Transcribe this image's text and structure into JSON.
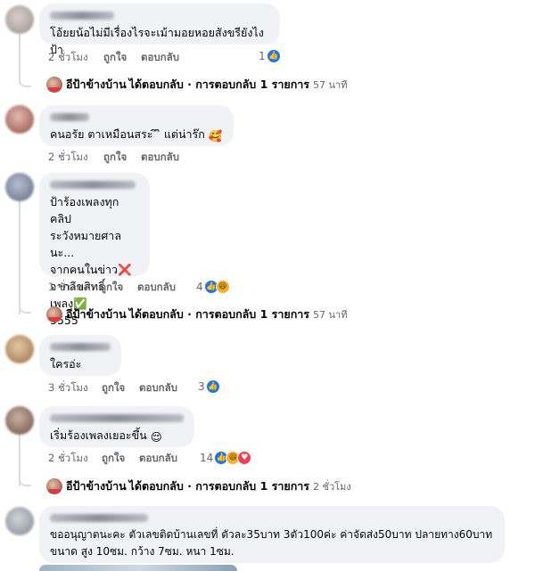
{
  "comments": [
    {
      "text": "โอ้ยยน้อไม่มีเรื่องไรจะเม้ามอยหอยสังขรียังไงป้า",
      "time": "2 ชั่วโมง",
      "like": "ถูกใจ",
      "reply": "ตอบกลับ",
      "reaction_count": "1"
    },
    {
      "text": "คนอรัย ตาเหมือนสระ ิ ิ แต่น่าร๊ก",
      "time": "2 ชั่วโมง",
      "like": "ถูกใจ",
      "reply": "ตอบกลับ"
    },
    {
      "text": "ป้าร้องเพลงทุกคลิป\nระวังหมายศาลนะ...\nจากคนในข่าว❌\nจากลิขสิทธิ์เพลง✅\n5555",
      "time": "1 ชั่วโมง",
      "like": "ถูกใจ",
      "reply": "ตอบกลับ",
      "reaction_count": "4"
    },
    {
      "text": "ใครอ่ะ",
      "time": "3 ชั่วโมง",
      "like": "ถูกใจ",
      "reply": "ตอบกลับ",
      "reaction_count": "3"
    },
    {
      "text": "เริ่มร้องเพลงเยอะขึ้น",
      "time": "2 ชั่วโมง",
      "like": "ถูกใจ",
      "reply": "ตอบกลับ",
      "reaction_count": "14"
    },
    {
      "text": "ขออนุญาตนะคะ ตัวเลขติดบ้านเลขที่ ตัวละ35บาท 3ตัว100ค่ะ ค่าจัดส่ง50บาท ปลายทาง60บาท\nขนาด สูง 10ซม. กว้าง 7ซม. หนา 1ซม."
    }
  ],
  "replies": [
    {
      "name": "อีป้าข้างบ้าน",
      "text": "ได้ตอบกลับ · การตอบกลับ 1 รายการ",
      "time": "57 นาที"
    },
    {
      "name": "อีป้าข้างบ้าน",
      "text": "ได้ตอบกลับ · การตอบกลับ 1 รายการ",
      "time": "57 นาที"
    },
    {
      "name": "อีป้าข้างบ้าน",
      "text": "ได้ตอบกลับ · การตอบกลับ 1 รายการ",
      "time": "2 ชั่วโมง"
    }
  ],
  "colors": {
    "accent": "#1877f2",
    "bubble": "#f0f2f5",
    "muted": "#65676b"
  },
  "icons": [
    "like-icon",
    "haha-icon",
    "love-icon",
    "heart-eyes-emoji",
    "relieved-emoji"
  ]
}
